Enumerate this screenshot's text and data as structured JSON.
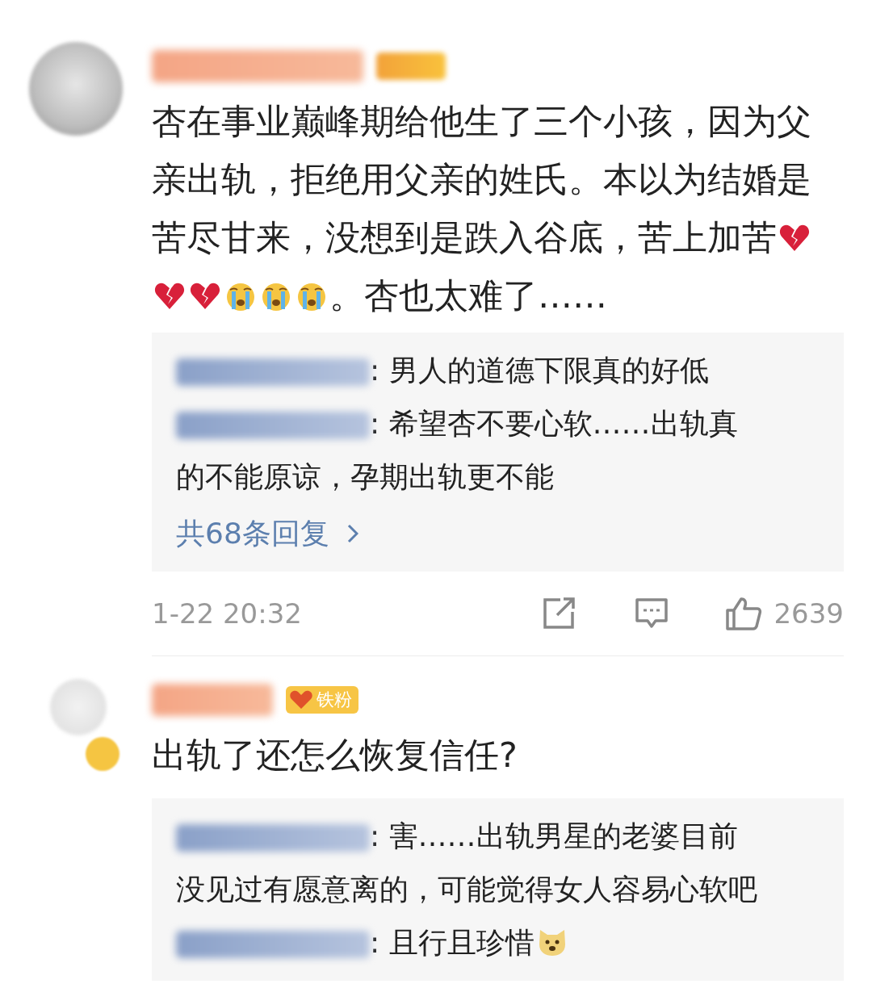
{
  "comments": [
    {
      "avatar_badge": false,
      "badge": {
        "kind": "blurred"
      },
      "body": [
        [
          {
            "kind": "text",
            "text": "杏在事业巅峰期给他生了三个小孩，因为父"
          }
        ],
        [
          {
            "kind": "text",
            "text": "亲出轨，拒绝用父亲的姓氏。本以为结婚是"
          }
        ],
        [
          {
            "kind": "text",
            "text": "苦尽甘来，没想到是跌入谷底，苦上加苦"
          },
          {
            "kind": "broken-heart"
          }
        ],
        [
          {
            "kind": "broken-heart"
          },
          {
            "kind": "broken-heart"
          },
          {
            "kind": "crying"
          },
          {
            "kind": "crying"
          },
          {
            "kind": "crying"
          },
          {
            "kind": "text",
            "text": "。杏也太难了……"
          }
        ]
      ],
      "replies": [
        {
          "lines": [
            [
              {
                "kind": "text",
                "text": ": 男人的道德下限真的好低"
              }
            ]
          ]
        },
        {
          "lines": [
            [
              {
                "kind": "text",
                "text": ": 希望杏不要心软……出轨真"
              }
            ],
            [
              {
                "kind": "text",
                "text": "的不能原谅，孕期出轨更不能"
              }
            ]
          ]
        }
      ],
      "more_replies": "共68条回复",
      "footer": {
        "time": "1-22 20:32",
        "likes": "2639"
      }
    },
    {
      "avatar_badge": true,
      "badge": {
        "kind": "fan",
        "label": "铁粉"
      },
      "body": [
        [
          {
            "kind": "text",
            "text": "出轨了还怎么恢复信任?"
          }
        ]
      ],
      "replies": [
        {
          "lines": [
            [
              {
                "kind": "text",
                "text": ": 害……出轨男星的老婆目前"
              }
            ],
            [
              {
                "kind": "text",
                "text": "没见过有愿意离的，可能觉得女人容易心软吧"
              }
            ]
          ]
        },
        {
          "lines": [
            [
              {
                "kind": "text",
                "text": ": 且行且珍惜"
              },
              {
                "kind": "dog"
              }
            ]
          ]
        }
      ]
    }
  ]
}
